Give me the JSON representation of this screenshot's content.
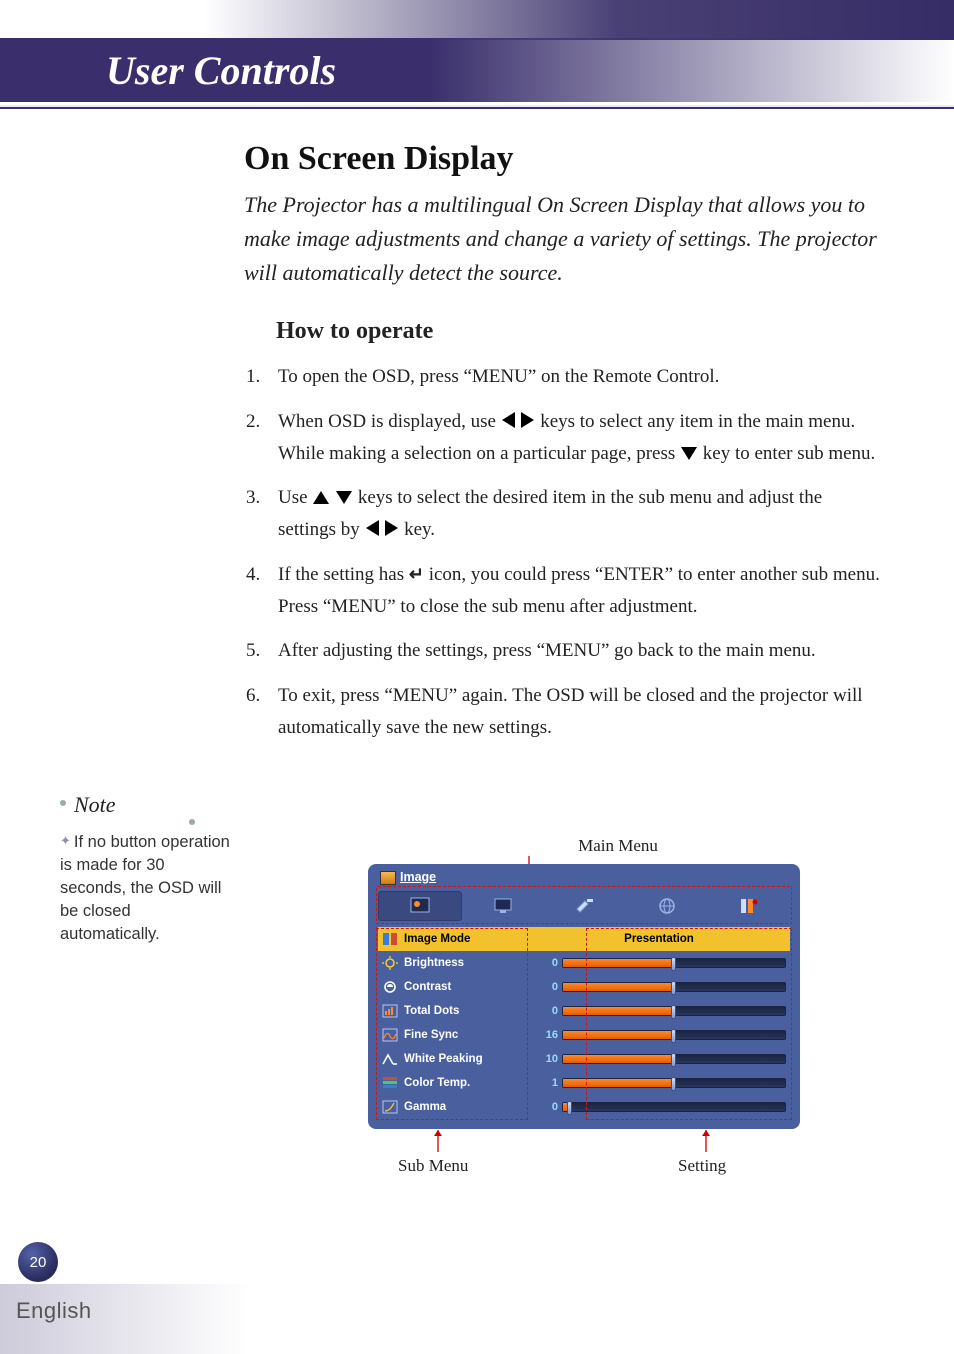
{
  "banner": {
    "title": "User Controls"
  },
  "section": {
    "heading": "On Screen Display",
    "intro": "The Projector has a multilingual On Screen Display that allows you to make image adjustments and change a variety of settings. The projector will automatically detect the source.",
    "subheading": "How to operate"
  },
  "steps": {
    "s1": "To open the OSD, press “MENU” on the Remote Control.",
    "s2a": "When OSD is displayed, use ",
    "s2b": " keys to select any item in the main menu. While making a selection on a particular page, press ",
    "s2c": " key to enter sub menu.",
    "s3a": "Use ",
    "s3b": " keys to select the desired item in the sub menu and adjust the settings by ",
    "s3c": " key.",
    "s4a": "If the setting has ",
    "s4b": " icon, you could press “ENTER” to enter another sub menu. Press “MENU” to close the sub menu after adjustment.",
    "s5": "After adjusting the settings, press “MENU” go back to the main menu.",
    "s6": "To exit, press “MENU” again. The OSD will be closed and the projector will automatically save the new settings."
  },
  "note": {
    "title": "Note",
    "body": "If no button operation is made for 30 seconds, the OSD will be closed automatically."
  },
  "diagram_labels": {
    "main_menu": "Main Menu",
    "sub_menu": "Sub Menu",
    "setting": "Setting"
  },
  "osd": {
    "title": "Image",
    "tabs": [
      "image",
      "screen",
      "setup",
      "language",
      "info"
    ],
    "rows": [
      {
        "label": "Image Mode",
        "value_text": "Presentation",
        "selected": true
      },
      {
        "label": "Brightness",
        "value_num": "0",
        "fill": 0.5
      },
      {
        "label": "Contrast",
        "value_num": "0",
        "fill": 0.5
      },
      {
        "label": "Total Dots",
        "value_num": "0",
        "fill": 0.5
      },
      {
        "label": "Fine Sync",
        "value_num": "16",
        "fill": 0.5
      },
      {
        "label": "White Peaking",
        "value_num": "10",
        "fill": 0.5
      },
      {
        "label": "Color Temp.",
        "value_num": "1",
        "fill": 0.5
      },
      {
        "label": "Gamma",
        "value_num": "0",
        "fill": 0.03
      }
    ]
  },
  "footer": {
    "page_number": "20",
    "language": "English"
  }
}
